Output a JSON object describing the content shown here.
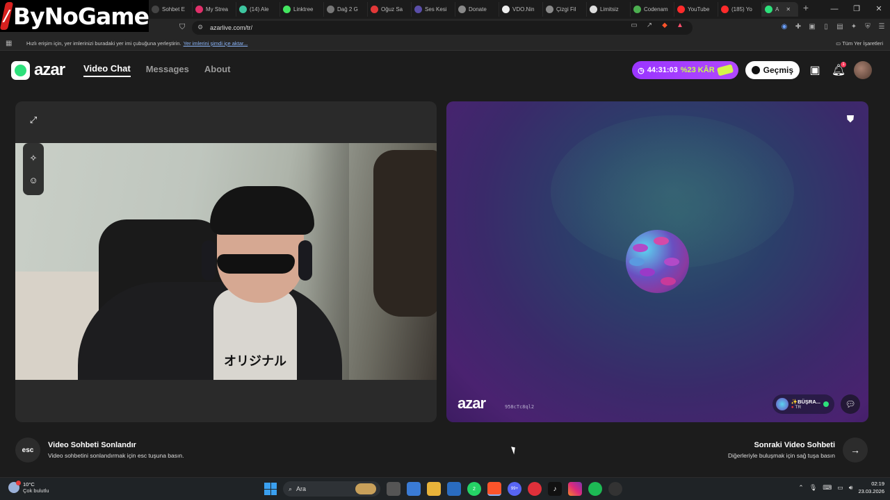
{
  "browser": {
    "tabs": [
      {
        "label": "Sohbet E",
        "color": "#444444"
      },
      {
        "label": "My Strea",
        "color": "#e0306a"
      },
      {
        "label": "(14) Ale",
        "color": "#3ec6a0"
      },
      {
        "label": "Linktree",
        "color": "#43e660"
      },
      {
        "label": "Dağ 2 G",
        "color": "#777777"
      },
      {
        "label": "Oğuz Sa",
        "color": "#e23838"
      },
      {
        "label": "Ses Kesi",
        "color": "#5a4ea8"
      },
      {
        "label": "Donate",
        "color": "#888888"
      },
      {
        "label": "VDO.Nin",
        "color": "#eeeeee"
      },
      {
        "label": "Çizgi Fil",
        "color": "#8a8a8a"
      },
      {
        "label": "Limitsiz",
        "color": "#dddddd"
      },
      {
        "label": "Codenam",
        "color": "#4caf50"
      },
      {
        "label": "YouTube",
        "color": "#ff2b2b"
      },
      {
        "label": "(185) Yo",
        "color": "#ff2b2b"
      },
      {
        "label": "A",
        "color": "#2de07b"
      }
    ],
    "url": "azarlive.com/tr/",
    "bookmark_hint": "Hızlı erişim için, yer imlerinizi buradaki yer imi çubuğuna yerleştirin.",
    "bookmark_link": "Yer imlerini şimdi içe aktar...",
    "all_bookmarks": "Tüm Yer İşaretleri"
  },
  "watermark": {
    "text": "ByNoGame"
  },
  "app": {
    "logo": "azar",
    "nav": [
      {
        "label": "Video Chat",
        "active": true
      },
      {
        "label": "Messages",
        "active": false
      },
      {
        "label": "About",
        "active": false
      }
    ],
    "timer": "44:31:03",
    "promo": "%23 KÂR",
    "history_label": "Geçmiş",
    "notification_count": "1"
  },
  "partner": {
    "watermark": "azar",
    "session_id": "958cTc8ql2",
    "name": "✨BÜŞRA...",
    "country": "TR"
  },
  "controls": {
    "esc_key": "esc",
    "end_title": "Video Sohbeti Sonlandır",
    "end_sub": "Video sohbetini sonlandırmak için esc tuşuna basın.",
    "next_title": "Sonraki Video Sohbeti",
    "next_sub": "Diğerleriyle buluşmak için sağ tuşa basın"
  },
  "webcam": {
    "shirt_text": "オリジナル"
  },
  "taskbar": {
    "temp": "10°C",
    "weather": "Çok bulutlu",
    "search": "Ara",
    "time": "02:19",
    "date": "23.03.2026",
    "discord_badge": "99+",
    "whatsapp_badge": "2"
  }
}
